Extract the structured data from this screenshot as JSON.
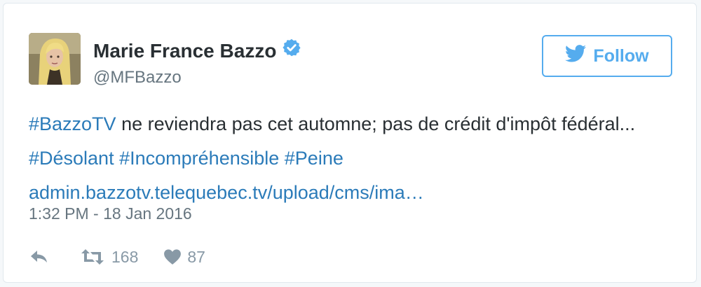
{
  "user": {
    "name": "Marie France Bazzo",
    "handle": "@MFBazzo",
    "verified_icon": "verified-badge-icon",
    "avatar": "profile-photo"
  },
  "follow_button": {
    "label": "Follow",
    "icon": "twitter-bird-icon"
  },
  "tweet": {
    "hashtag_1": "#BazzoTV",
    "text_1": " ne reviendra pas cet automne; pas de crédit d'impôt fédéral... ",
    "hashtag_2": "#Désolant",
    "hashtag_3": "#Incompréhensible",
    "hashtag_4": "#Peine",
    "link": "admin.bazzotv.telequebec.tv/upload/cms/ima…"
  },
  "timestamp": "1:32 PM - 18 Jan 2016",
  "actions": {
    "reply_icon": "reply-icon",
    "retweet_icon": "retweet-icon",
    "retweet_count": "168",
    "like_icon": "heart-icon",
    "like_count": "87"
  },
  "colors": {
    "accent": "#55acee",
    "link": "#2b7bb9",
    "text": "#292f33",
    "muted": "#66757f",
    "action": "#8899a6"
  }
}
